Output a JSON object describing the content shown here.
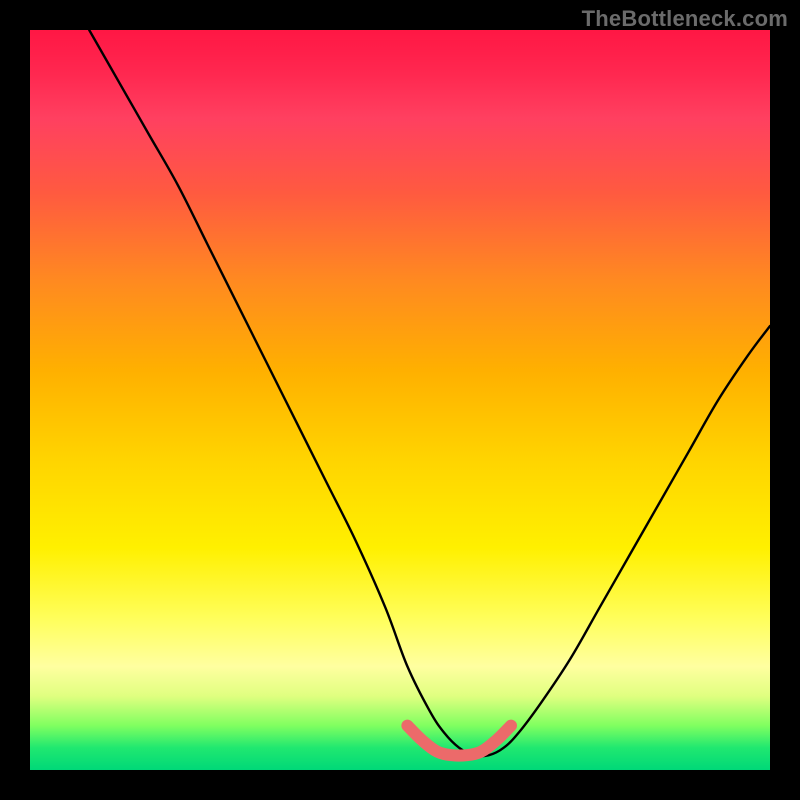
{
  "watermark": "TheBottleneck.com",
  "chart_data": {
    "type": "line",
    "title": "",
    "xlabel": "",
    "ylabel": "",
    "xlim": [
      0,
      100
    ],
    "ylim": [
      0,
      100
    ],
    "series": [
      {
        "name": "bottleneck-curve",
        "x": [
          8,
          12,
          16,
          20,
          24,
          28,
          32,
          36,
          40,
          44,
          48,
          51,
          54,
          56,
          58,
          60,
          62,
          64,
          66,
          69,
          73,
          77,
          81,
          85,
          89,
          93,
          97,
          100
        ],
        "y": [
          100,
          93,
          86,
          79,
          71,
          63,
          55,
          47,
          39,
          31,
          22,
          14,
          8,
          5,
          3,
          2,
          2,
          3,
          5,
          9,
          15,
          22,
          29,
          36,
          43,
          50,
          56,
          60
        ]
      },
      {
        "name": "optimal-zone",
        "x": [
          51,
          53,
          55,
          57,
          59,
          61,
          63,
          65
        ],
        "y": [
          6,
          4,
          2.5,
          2,
          2,
          2.5,
          4,
          6
        ]
      }
    ],
    "colors": {
      "curve": "#000000",
      "optimal": "#ec6a6a",
      "gradient_top": "#ff1744",
      "gradient_bottom": "#00d878"
    }
  }
}
